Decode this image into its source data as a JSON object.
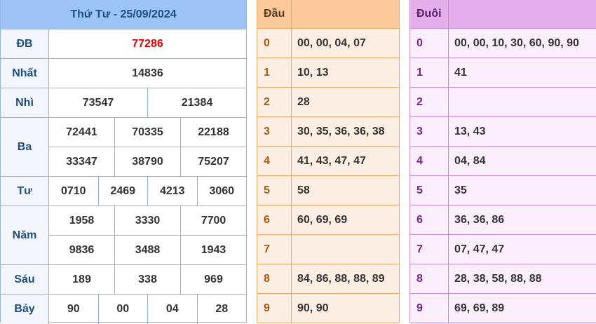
{
  "results": {
    "title": "Thứ Tư - 25/09/2024",
    "prizes": [
      {
        "name": "ĐB",
        "lines": [
          [
            "77286"
          ]
        ],
        "special": true
      },
      {
        "name": "Nhất",
        "lines": [
          [
            "14836"
          ]
        ]
      },
      {
        "name": "Nhì",
        "lines": [
          [
            "73547",
            "21384"
          ]
        ]
      },
      {
        "name": "Ba",
        "lines": [
          [
            "72441",
            "70335",
            "22188"
          ],
          [
            "33347",
            "38790",
            "75207"
          ]
        ]
      },
      {
        "name": "Tư",
        "lines": [
          [
            "0710",
            "2469",
            "4213",
            "3060"
          ]
        ]
      },
      {
        "name": "Năm",
        "lines": [
          [
            "1958",
            "3330",
            "7700"
          ],
          [
            "9836",
            "3488",
            "1943"
          ]
        ]
      },
      {
        "name": "Sáu",
        "lines": [
          [
            "189",
            "338",
            "969"
          ]
        ]
      },
      {
        "name": "Bảy",
        "lines": [
          [
            "90",
            "00",
            "04",
            "28"
          ]
        ]
      }
    ]
  },
  "dau": {
    "header": "Đầu",
    "rows": [
      {
        "key": "0",
        "values": "00, 00, 04, 07"
      },
      {
        "key": "1",
        "values": "10, 13"
      },
      {
        "key": "2",
        "values": "28"
      },
      {
        "key": "3",
        "values": "30, 35, 36, 36, 38"
      },
      {
        "key": "4",
        "values": "41, 43, 47, 47"
      },
      {
        "key": "5",
        "values": "58"
      },
      {
        "key": "6",
        "values": "60, 69, 69"
      },
      {
        "key": "7",
        "values": ""
      },
      {
        "key": "8",
        "values": "84, 86, 88, 88, 89"
      },
      {
        "key": "9",
        "values": "90, 90"
      }
    ]
  },
  "duoi": {
    "header": "Đuôi",
    "rows": [
      {
        "key": "0",
        "values": "00, 00, 10, 30, 60, 90, 90"
      },
      {
        "key": "1",
        "values": "41"
      },
      {
        "key": "2",
        "values": ""
      },
      {
        "key": "3",
        "values": "13, 43"
      },
      {
        "key": "4",
        "values": "04, 84"
      },
      {
        "key": "5",
        "values": "35"
      },
      {
        "key": "6",
        "values": "36, 36, 86"
      },
      {
        "key": "7",
        "values": "07, 47, 47"
      },
      {
        "key": "8",
        "values": "28, 38, 58, 88, 88"
      },
      {
        "key": "9",
        "values": "69, 69, 89"
      }
    ]
  }
}
